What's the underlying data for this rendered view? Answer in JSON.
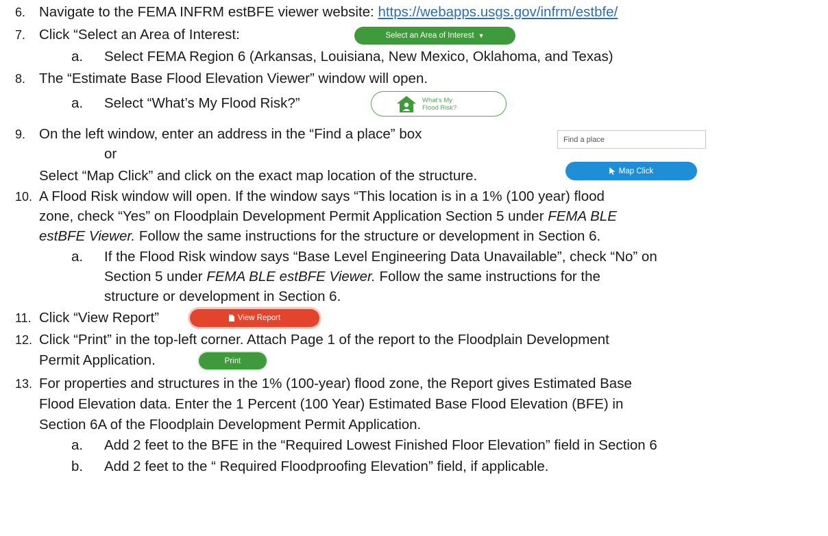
{
  "items": {
    "s6": {
      "num": "6.",
      "text": "Navigate to the FEMA INFRM estBFE viewer website: ",
      "link": "https://webapps.usgs.gov/infrm/estbfe/"
    },
    "s7": {
      "num": "7.",
      "text": "Click “Select an Area of Interest:",
      "button": "Select an Area of Interest"
    },
    "s7a": {
      "letter": "a.",
      "text": "Select FEMA Region 6 (Arkansas, Louisiana, New Mexico, Oklahoma, and Texas)"
    },
    "s8": {
      "num": "8.",
      "text": "The “Estimate Base Flood Elevation Viewer” window will open."
    },
    "s8a": {
      "letter": "a.",
      "text": "Select “What’s My Flood Risk?”",
      "button_line1": "What's My",
      "button_line2": "Flood Risk?"
    },
    "s9": {
      "num": "9.",
      "text": "On the left window, enter an address in the “Find a place” box",
      "placeholder": "Find a place",
      "or": "or",
      "text2": "Select “Map Click” and click on the exact map location of the structure.",
      "button": "Map Click"
    },
    "s10": {
      "num": "10.",
      "line1": "A Flood Risk window will open.  If the window says “This location is in a 1% (100 year) flood",
      "line2a": "zone, check “Yes” on Floodplain Development Permit Application Section 5 under ",
      "line2b": "FEMA BLE",
      "line3a": "estBFE Viewer.",
      "line3b": "  Follow the same instructions for the structure or development in Section 6."
    },
    "s10a": {
      "letter": "a.",
      "line1": "If the Flood Risk window says “Base Level Engineering Data Unavailable”, check “No” on",
      "line2a": "Section 5 under ",
      "line2b": "FEMA BLE estBFE Viewer.",
      "line2c": "  Follow the same instructions for the",
      "line3": "structure or development in Section 6."
    },
    "s11": {
      "num": "11.",
      "text": "Click “View Report”",
      "button": "View Report"
    },
    "s12": {
      "num": "12.",
      "line1": "Click “Print” in the top-left corner.  Attach Page 1 of the report to the Floodplain Development",
      "line2": "Permit Application.",
      "button": "Print"
    },
    "s13": {
      "num": "13.",
      "line1": "For properties and structures in the 1% (100-year) flood zone, the Report gives Estimated Base",
      "line2": "Flood Elevation data.  Enter the 1 Percent (100 Year) Estimated Base Flood Elevation (BFE) in",
      "line3": "Section 6A of the Floodplain Development Permit Application."
    },
    "s13a": {
      "letter": "a.",
      "text": "Add 2 feet to the BFE in the “Required Lowest Finished Floor Elevation” field in Section 6"
    },
    "s13b": {
      "letter": "b.",
      "text": "Add 2 feet to the “ Required Floodproofing Elevation” field, if applicable."
    }
  }
}
